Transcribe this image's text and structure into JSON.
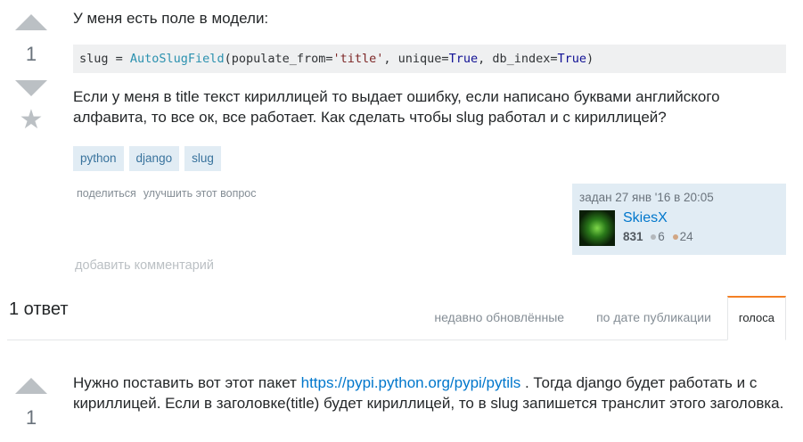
{
  "question": {
    "vote_count": "1",
    "intro": "У меня есть поле в модели:",
    "code": {
      "p1": "slug = ",
      "type": "AutoSlugField",
      "p2": "(populate_from=",
      "str": "'title'",
      "p3": ", unique=",
      "kw1": "True",
      "p4": ", db_index=",
      "kw2": "True",
      "p5": ")"
    },
    "body": "Если у меня в title текст кириллицей то выдает ошибку, если написано буквами английского алфавита, то все ок, все работает. Как сделать чтобы slug работал и с кириллицей?",
    "tags": [
      "python",
      "django",
      "slug"
    ],
    "menu": {
      "share": "поделиться",
      "improve": "улучшить этот вопрос"
    },
    "asked": "задан 27 янв '16 в 20:05",
    "user": {
      "name": "SkiesX",
      "reputation": "831",
      "silver": "6",
      "bronze": "24"
    },
    "add_comment": "добавить комментарий"
  },
  "answers": {
    "count_label": "1 ответ",
    "tabs": [
      "недавно обновлённые",
      "по дате публикации",
      "голоса"
    ],
    "active_tab": "голоса"
  },
  "answer": {
    "vote_count": "1",
    "text_before": "Нужно поставить вот этот пакет ",
    "link": "https://pypi.python.org/pypi/pytils",
    "text_after": " . Тогда django будет работать и с кириллицей. Если в заголовке(title) будет кириллицей, то в slug запишется транслит этого заголовка."
  },
  "colors": {
    "accent": "#f48024",
    "link": "#0077cc",
    "tag_bg": "#e1ecf4",
    "silver_badge": "#b4b8bc",
    "bronze_badge": "#d1a684"
  }
}
